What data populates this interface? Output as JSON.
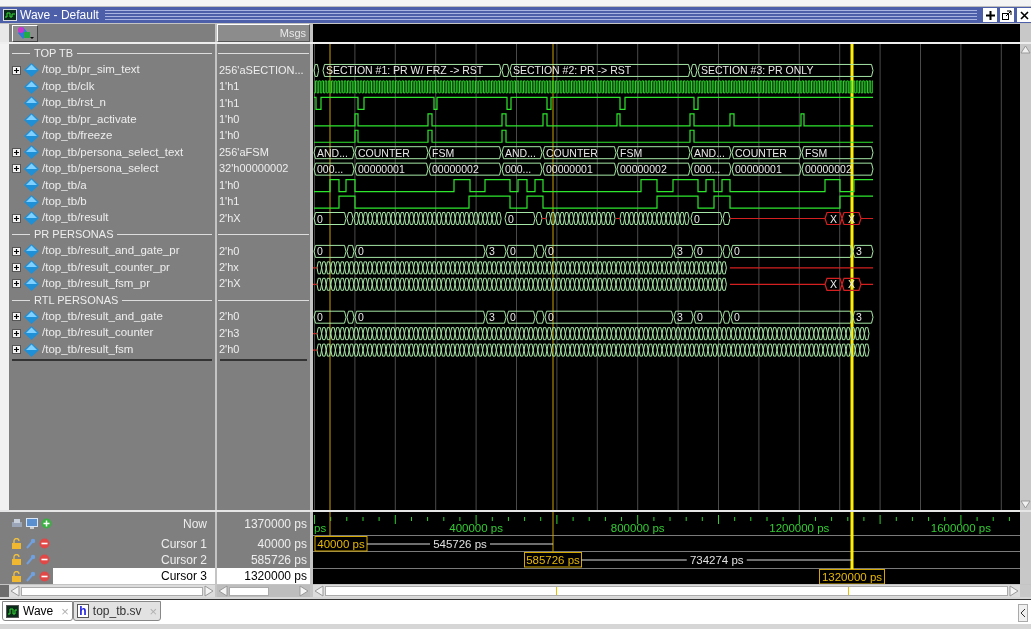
{
  "window": {
    "title": "Wave - Default"
  },
  "msgs_header": "Msgs",
  "groups": [
    {
      "label": "TOP TB",
      "signals": [
        {
          "name": "/top_tb/pr_sim_text",
          "value": "256'aSECTION...",
          "expandable": true,
          "kind": "bus",
          "labels": [
            "SECTION #1: PR W/ FRZ -> RST",
            "SECTION #2: PR -> RST",
            "SECTION #3: PR ONLY"
          ]
        },
        {
          "name": "/top_tb/clk",
          "value": "1'h1",
          "expandable": false,
          "kind": "clock"
        },
        {
          "name": "/top_tb/rst_n",
          "value": "1'h1",
          "expandable": false,
          "kind": "bit"
        },
        {
          "name": "/top_tb/pr_activate",
          "value": "1'h0",
          "expandable": false,
          "kind": "bit"
        },
        {
          "name": "/top_tb/freeze",
          "value": "1'h0",
          "expandable": false,
          "kind": "bit"
        },
        {
          "name": "/top_tb/persona_select_text",
          "value": "256'aFSM",
          "expandable": true,
          "kind": "bus",
          "labels": [
            "AND...",
            "COUNTER",
            "FSM",
            "AND...",
            "COUNTER",
            "FSM",
            "AND...",
            "COUNTER",
            "FSM"
          ]
        },
        {
          "name": "/top_tb/persona_select",
          "value": "32'h00000002",
          "expandable": true,
          "kind": "bus",
          "labels": [
            "000...",
            "00000001",
            "00000002",
            "000...",
            "00000001",
            "00000002",
            "000...",
            "00000001",
            "00000002"
          ]
        },
        {
          "name": "/top_tb/a",
          "value": "1'h0",
          "expandable": false,
          "kind": "bit"
        },
        {
          "name": "/top_tb/b",
          "value": "1'h1",
          "expandable": false,
          "kind": "bit"
        },
        {
          "name": "/top_tb/result",
          "value": "2'hX",
          "expandable": true,
          "kind": "bus",
          "labels": [
            "0",
            "0",
            "0",
            "X",
            "X"
          ]
        }
      ]
    },
    {
      "label": "PR PERSONAS",
      "signals": [
        {
          "name": "/top_tb/result_and_gate_pr",
          "value": "2'h0",
          "expandable": true,
          "kind": "bus",
          "labels": [
            "0",
            "0",
            "3",
            "0",
            "0",
            "3",
            "0",
            "0",
            "3"
          ]
        },
        {
          "name": "/top_tb/result_counter_pr",
          "value": "2'hx",
          "expandable": true,
          "kind": "bus"
        },
        {
          "name": "/top_tb/result_fsm_pr",
          "value": "2'hX",
          "expandable": true,
          "kind": "bus",
          "labels": [
            "X",
            "X"
          ]
        }
      ]
    },
    {
      "label": "RTL PERSONAS",
      "signals": [
        {
          "name": "/top_tb/result_and_gate",
          "value": "2'h0",
          "expandable": true,
          "kind": "bus",
          "labels": [
            "0",
            "0",
            "3",
            "0",
            "0",
            "3",
            "0",
            "0",
            "3"
          ]
        },
        {
          "name": "/top_tb/result_counter",
          "value": "2'h3",
          "expandable": true,
          "kind": "bus"
        },
        {
          "name": "/top_tb/result_fsm",
          "value": "2'h0",
          "expandable": true,
          "kind": "bus"
        }
      ]
    }
  ],
  "now": {
    "label": "Now",
    "value": "1370000 ps"
  },
  "cursors": [
    {
      "label": "Cursor 1",
      "value": "40000 ps",
      "flag": "40000 ps",
      "selected": false
    },
    {
      "label": "Cursor 2",
      "value": "585726 ps",
      "flag": "585726 ps",
      "selected": false
    },
    {
      "label": "Cursor 3",
      "value": "1320000 ps",
      "flag": "1320000 ps",
      "selected": true
    }
  ],
  "deltas": [
    "545726 ps",
    "734274 ps"
  ],
  "ruler": [
    "ps",
    "400000 ps",
    "800000 ps",
    "1200000 ps",
    "1600000 ps"
  ],
  "tabs": [
    {
      "label": "Wave",
      "close": "×",
      "selected": true,
      "kind": "wave"
    },
    {
      "label": "top_tb.sv",
      "close": "×",
      "selected": false,
      "kind": "file",
      "badge": "h"
    }
  ]
}
